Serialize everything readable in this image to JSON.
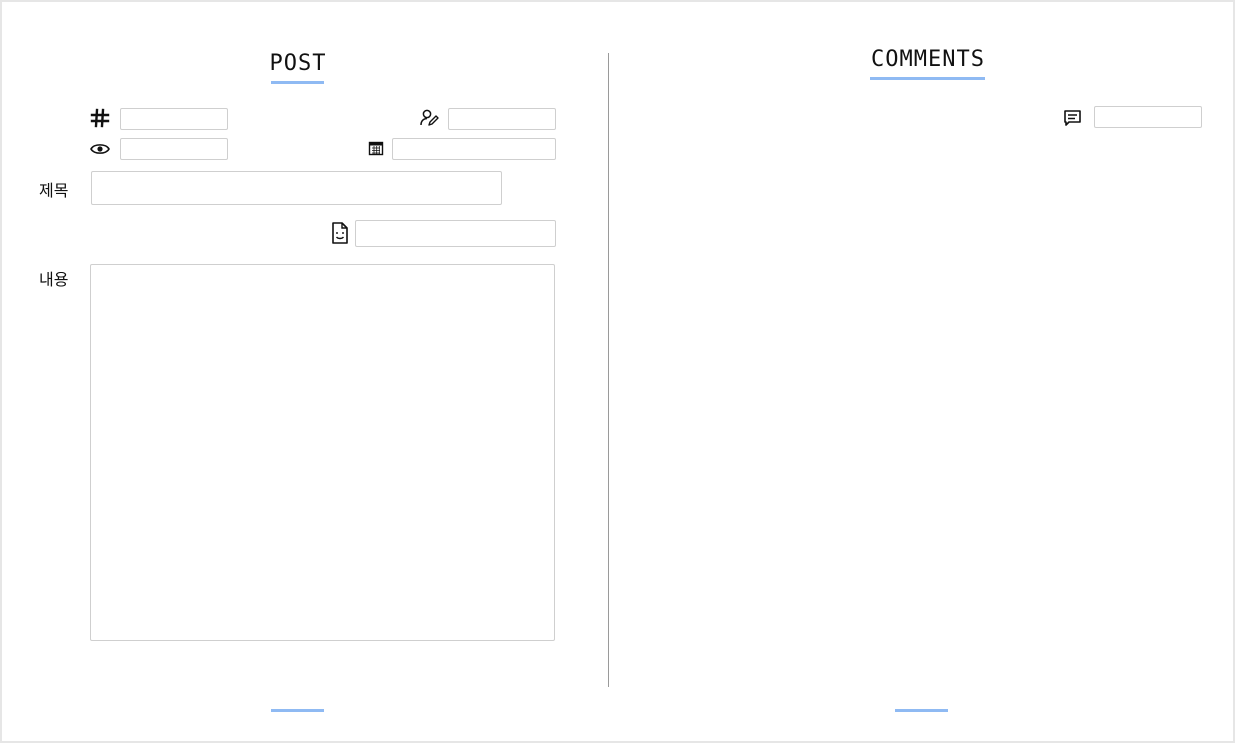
{
  "post": {
    "heading": "POST",
    "id_field": {
      "value": "",
      "placeholder": ""
    },
    "author_field": {
      "value": "",
      "placeholder": ""
    },
    "views_field": {
      "value": "",
      "placeholder": ""
    },
    "date_field": {
      "value": "",
      "placeholder": ""
    },
    "title_label": "제목",
    "title_field": {
      "value": "",
      "placeholder": ""
    },
    "file_field": {
      "value": "",
      "placeholder": ""
    },
    "content_label": "내용",
    "content_field": {
      "value": "",
      "placeholder": ""
    },
    "icons": [
      "hash-icon",
      "author-edit-icon",
      "eye-icon",
      "calendar-icon",
      "file-icon"
    ]
  },
  "comments": {
    "heading": "COMMENTS",
    "comment_field": {
      "value": "",
      "placeholder": ""
    },
    "icons": [
      "comment-icon"
    ]
  },
  "colors": {
    "accent": "#8fbaf3",
    "border": "#cfcfcf",
    "divider": "#9a9a9a"
  }
}
